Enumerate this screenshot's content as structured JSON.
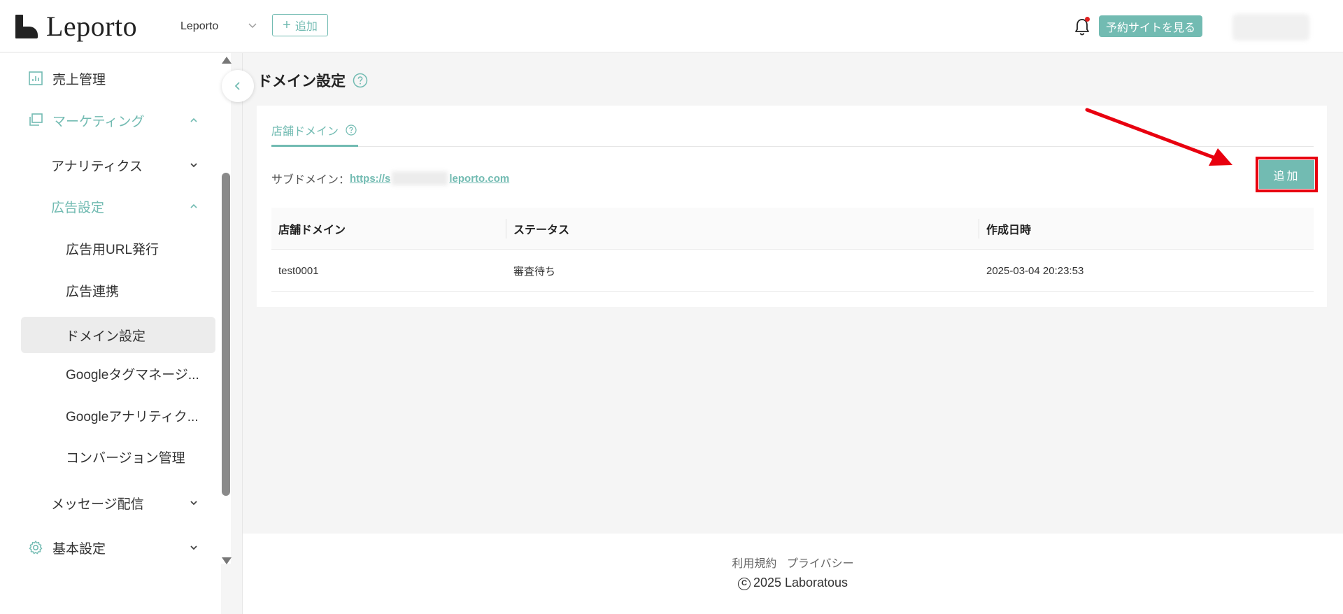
{
  "header": {
    "logo_text": "Leporto",
    "store_name": "Leporto",
    "add_label": "追加",
    "view_site_label": "予約サイトを見る"
  },
  "sidebar": {
    "items": [
      {
        "label": "売上管理",
        "icon": "chart-icon"
      },
      {
        "label": "マーケティング",
        "icon": "marketing-icon",
        "expanded": true
      },
      {
        "label": "アナリティクス"
      },
      {
        "label": "広告設定",
        "expanded": true
      },
      {
        "label": "広告用URL発行"
      },
      {
        "label": "広告連携"
      },
      {
        "label": "ドメイン設定",
        "active": true
      },
      {
        "label": "Googleタグマネージ..."
      },
      {
        "label": "Googleアナリティク..."
      },
      {
        "label": "コンバージョン管理"
      },
      {
        "label": "メッセージ配信"
      },
      {
        "label": "基本設定",
        "icon": "gear-icon"
      }
    ]
  },
  "main": {
    "title": "ドメイン設定",
    "tab_label": "店舗ドメイン",
    "subdomain_label": "サブドメイン：",
    "subdomain_link_start": "https://s",
    "subdomain_link_end": "leporto.com",
    "add_button": "追加",
    "table": {
      "headers": [
        "店舗ドメイン",
        "ステータス",
        "作成日時"
      ],
      "rows": [
        [
          "test0001",
          "審査待ち",
          "2025-03-04 20:23:53"
        ]
      ]
    }
  },
  "footer": {
    "terms": "利用規約",
    "privacy": "プライバシー",
    "copyright": "2025 Laboratous"
  },
  "colors": {
    "accent": "#72bbb2",
    "annotation": "#e8000f"
  }
}
